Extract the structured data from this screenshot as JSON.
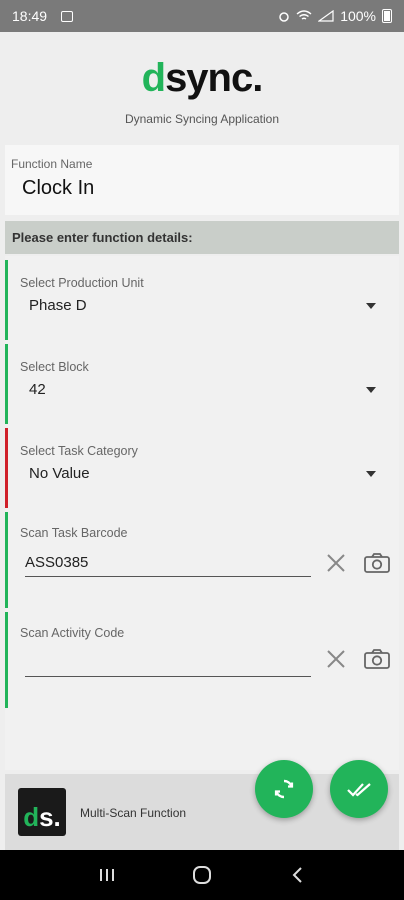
{
  "status": {
    "time": "18:49",
    "battery": "100%"
  },
  "brand": {
    "logo_d": "d",
    "logo_rest": "sync.",
    "tagline": "Dynamic Syncing Application",
    "accent": "#22b45a"
  },
  "function": {
    "label": "Function Name",
    "value": "Clock In"
  },
  "details_header": "Please enter function details:",
  "fields": [
    {
      "label": "Select Production Unit",
      "value": "Phase D",
      "status_color": "#22b45a"
    },
    {
      "label": "Select Block",
      "value": "42",
      "status_color": "#22b45a"
    },
    {
      "label": "Select Task Category",
      "value": "No Value",
      "status_color": "#d0202a"
    }
  ],
  "scans": [
    {
      "label": "Scan Task Barcode",
      "value": "ASS0385",
      "status_color": "#22b45a"
    },
    {
      "label": "Scan Activity Code",
      "value": "",
      "status_color": "#22b45a"
    }
  ],
  "footer": {
    "logo_d": "d",
    "logo_s": "s.",
    "label": "Multi-Scan Function"
  },
  "icons": {
    "sync": "sync-icon",
    "done": "done-all-icon",
    "clear": "clear-icon",
    "camera": "camera-icon"
  }
}
